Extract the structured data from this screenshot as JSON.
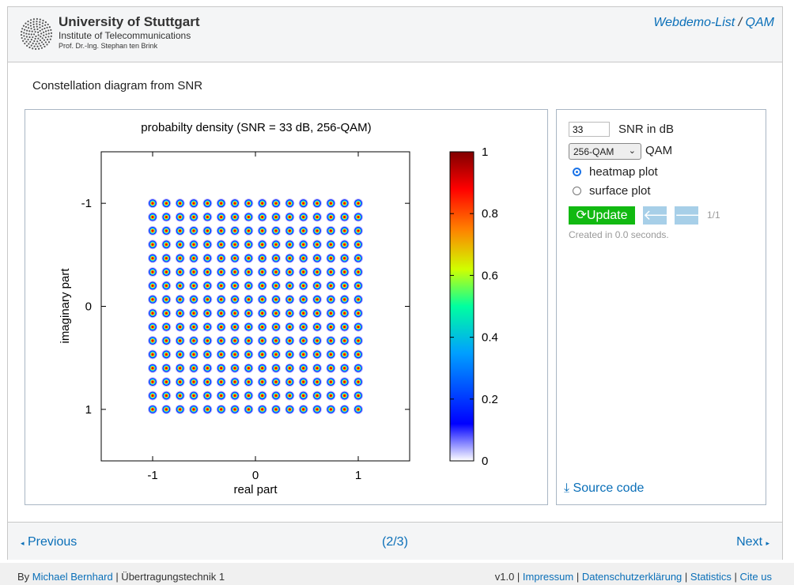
{
  "header": {
    "university": "University of Stuttgart",
    "institute": "Institute of Telecommunications",
    "professor": "Prof. Dr.-Ing. Stephan ten Brink",
    "breadcrumb": {
      "list": "Webdemo-List",
      "separator": "/",
      "current": "QAM"
    }
  },
  "page_title": "Constellation diagram from SNR",
  "controls": {
    "snr_value": "33",
    "snr_label": "SNR in dB",
    "qam_selected": "256-QAM",
    "qam_label": "QAM",
    "radio_heatmap": "heatmap plot",
    "radio_surface": "surface plot",
    "selected_plot": "heatmap",
    "update_label": "Update",
    "left_arrow": "🡐",
    "right_arrow": "🡒",
    "page_counter": "1/1",
    "created": "Created in 0.0 seconds.",
    "source_code": "Source code"
  },
  "nav": {
    "previous": "Previous",
    "position": "(2/3)",
    "next": "Next"
  },
  "footer": {
    "by": "By",
    "author": "Michael Bernhard",
    "course": "| Übertragungstechnik 1",
    "version": "v1.0 |",
    "links": [
      "Impressum",
      "Datenschutzerklärung",
      "Statistics",
      "Cite us"
    ]
  },
  "chart_data": {
    "type": "heatmap",
    "title": "probabilty density (SNR = 33 dB, 256-QAM)",
    "xlabel": "real part",
    "ylabel": "imaginary part",
    "xlim": [
      -1.5,
      1.5
    ],
    "ylim": [
      -1.5,
      1.5
    ],
    "y_inverted": true,
    "xticks": [
      "-1",
      "0",
      "1"
    ],
    "yticks": [
      "-1",
      "0",
      "1"
    ],
    "points_per_axis": 16,
    "point_range": [
      -1,
      1
    ],
    "colorbar": {
      "range": [
        0,
        1
      ],
      "ticks": [
        "0",
        "0.2",
        "0.4",
        "0.6",
        "0.8",
        "1"
      ]
    }
  },
  "colors": {
    "link": "#0a6fb8",
    "update": "#11b911"
  }
}
